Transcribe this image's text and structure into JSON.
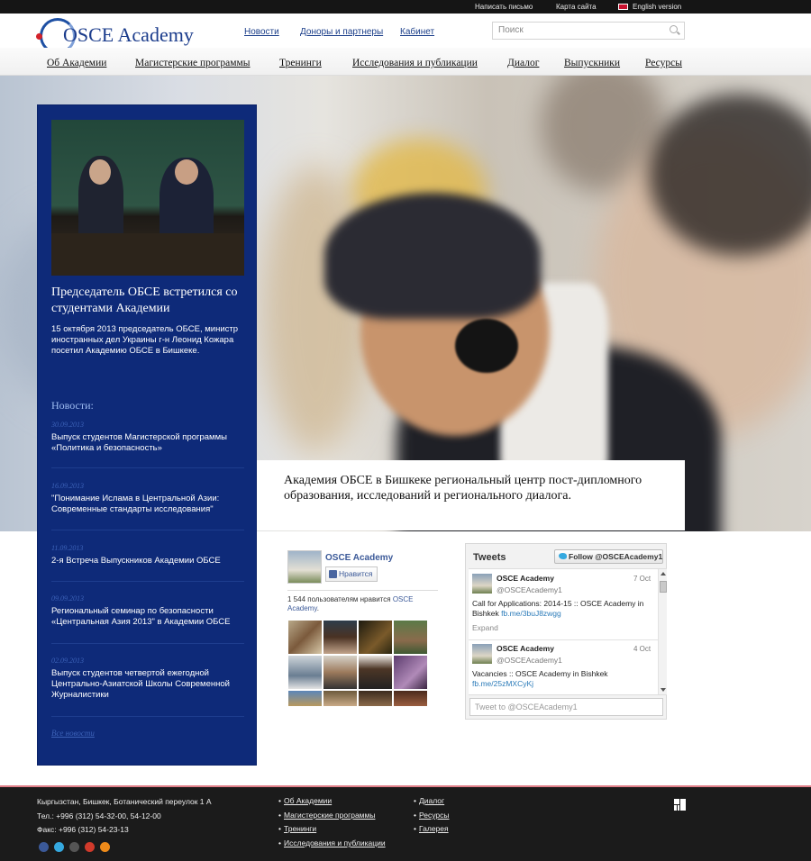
{
  "topbar": {
    "write_letter": "Написать письмо",
    "sitemap": "Карта сайта",
    "english": "English version"
  },
  "header": {
    "logo_text": "OSCE Academy",
    "links": [
      "Новости",
      "Доноры и партнеры",
      "Кабинет"
    ],
    "search_placeholder": "Поиск"
  },
  "nav": {
    "items": [
      "Об Академии",
      "Магистерские программы",
      "Тренинги",
      "Исследования и публикации",
      "Диалог",
      "Выпускники",
      "Ресурсы"
    ]
  },
  "hero": {
    "caption": "Академия ОБСЕ в Бишкеке региональный центр пост-дипломного образования, исследований и регионального диалога."
  },
  "feature": {
    "title": "Председатель ОБСЕ встретился со студентами Академии",
    "text": "15 октября 2013 председатель ОБСЕ, министр иностранных дел Украины г-н Леонид Кожара посетил Академию ОБСЕ в Бишкеке."
  },
  "news": {
    "heading": "Новости:",
    "items": [
      {
        "date": "30.09.2013",
        "title": "Выпуск студентов Магистерской программы «Политика и безопасность»"
      },
      {
        "date": "16.09.2013",
        "title": "\"Понимание Ислама в Центральной Азии: Современные стандарты исследования\""
      },
      {
        "date": "11.09.2013",
        "title": "2-я Встреча Выпускников Академии ОБСЕ"
      },
      {
        "date": "09.09.2013",
        "title": "Региональный семинар по безопасности «Центральная Азия 2013\" в Академии ОБСЕ"
      },
      {
        "date": "02.09.2013",
        "title": "Выпуск студентов четвертой ежегодной Центрально-Азиатской Школы Современной Журналистики"
      }
    ],
    "all": "Все новости"
  },
  "facebook": {
    "page_name": "OSCE Academy",
    "like_button": "Нравится",
    "count_text": "1 544 пользователям нравится",
    "count_link": "OSCE Academy",
    "count_end": "."
  },
  "twitter": {
    "title": "Tweets",
    "follow": "Follow @OSCEAcademy1",
    "tweets": [
      {
        "name": "OSCE Academy",
        "handle": "@OSCEAcademy1",
        "date": "7 Oct",
        "text": "Call for Applications: 2014-15 :: OSCE Academy in Bishkek",
        "link": "fb.me/3buJ8zwgg",
        "expand": "Expand"
      },
      {
        "name": "OSCE Academy",
        "handle": "@OSCEAcademy1",
        "date": "4 Oct",
        "text": "Vacancies :: OSCE Academy in Bishkek",
        "link": "fb.me/25zMXCyKj"
      }
    ],
    "input_placeholder": "Tweet to @OSCEAcademy1"
  },
  "footer": {
    "address": "Кыргызстан, Бишкек, Ботанический переулок 1 А",
    "phone": "Тел.: +996 (312) 54-32-00, 54-12-00",
    "fax": "Факс: +996 (312) 54-23-13",
    "col1": [
      "Об Академии",
      "Магистерские программы",
      "Тренинги",
      "Исследования и публикации"
    ],
    "col2": [
      "Диалог",
      "Ресурсы",
      "Галерея"
    ],
    "social_icons": [
      "facebook-icon",
      "twitter-icon",
      "youtube-icon",
      "google-plus-icon",
      "odnoklassniki-icon"
    ]
  },
  "colors": {
    "brand_blue": "#1b3c8c",
    "panel_blue": "#0e2a79",
    "footer_bg": "#1b1b1b",
    "accent_red": "#d3222a"
  }
}
